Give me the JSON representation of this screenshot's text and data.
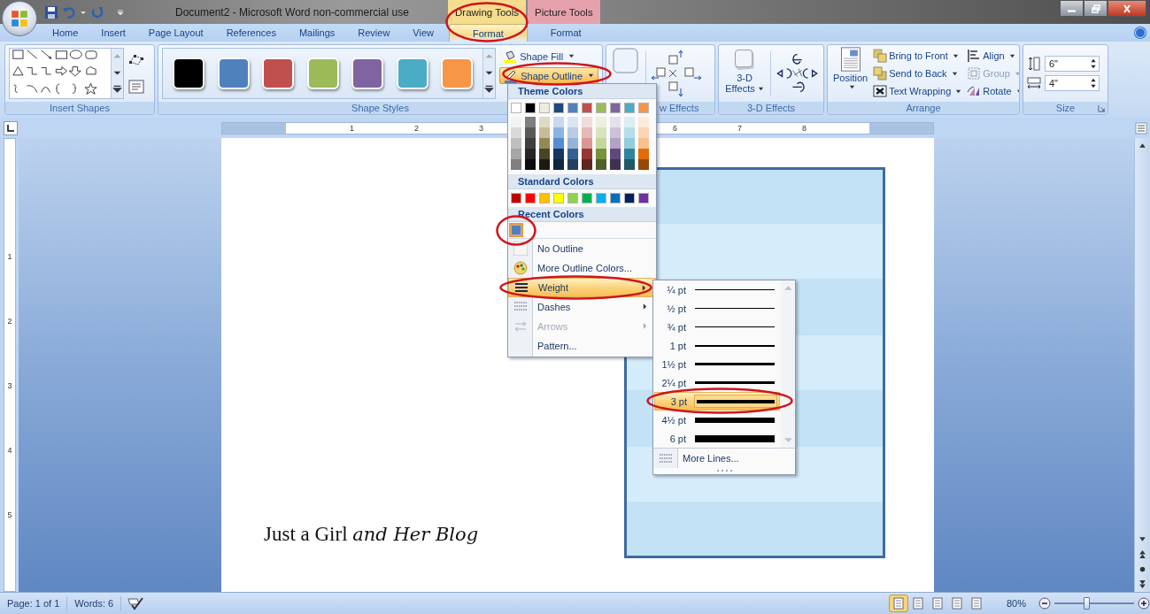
{
  "window": {
    "title": "Document2 - Microsoft Word non-commercial use",
    "contextual": [
      {
        "label": "Drawing Tools",
        "color": "#f6dc8e"
      },
      {
        "label": "Picture Tools",
        "color": "#e6a2ac"
      }
    ]
  },
  "tabs": [
    {
      "label": "Home",
      "selected": false,
      "kind": "standard"
    },
    {
      "label": "Insert",
      "selected": false,
      "kind": "standard"
    },
    {
      "label": "Page Layout",
      "selected": false,
      "kind": "standard"
    },
    {
      "label": "References",
      "selected": false,
      "kind": "standard"
    },
    {
      "label": "Mailings",
      "selected": false,
      "kind": "standard"
    },
    {
      "label": "Review",
      "selected": false,
      "kind": "standard"
    },
    {
      "label": "View",
      "selected": false,
      "kind": "standard"
    },
    {
      "label": "Format",
      "selected": true,
      "kind": "contextual"
    },
    {
      "label": "Format",
      "selected": false,
      "kind": "contextual"
    }
  ],
  "insert_shapes": {
    "label": "Insert Shapes"
  },
  "shape_styles": {
    "label": "Shape Styles",
    "swatches": [
      {
        "color": "#000000"
      },
      {
        "color": "#4f81bd"
      },
      {
        "color": "#c0504d"
      },
      {
        "color": "#9bbb59"
      },
      {
        "color": "#8064a2"
      },
      {
        "color": "#4bacc6"
      },
      {
        "color": "#f79646"
      }
    ],
    "fill": "Shape Fill",
    "outline": {
      "label": "Shape Outline",
      "open": true
    }
  },
  "shadow_effects": {
    "label": "w Effects"
  },
  "three_d_effects": {
    "button": "3-D Effects",
    "label": "3-D Effects"
  },
  "arrange": {
    "label": "Arrange",
    "position": "Position",
    "commands": [
      {
        "label": "Bring to Front",
        "disabled": false
      },
      {
        "label": "Send to Back",
        "disabled": false
      },
      {
        "label": "Text Wrapping",
        "disabled": false
      },
      {
        "label": "Align",
        "disabled": false
      },
      {
        "label": "Group",
        "disabled": true
      },
      {
        "label": "Rotate",
        "disabled": false
      }
    ]
  },
  "size": {
    "label": "Size",
    "height": "6\"",
    "width": "4\""
  },
  "ruler": {
    "numbers": [
      "1",
      "2",
      "3",
      "6",
      "7",
      "8"
    ]
  },
  "vertical_ruler": {
    "numbers": [
      "1",
      "2",
      "3",
      "4",
      "5"
    ]
  },
  "document": {
    "text": "Just a Girl *and Her Blog*"
  },
  "outline_menu": {
    "theme_heading": "Theme Colors",
    "theme_colors": [
      {
        "color": "#ffffff",
        "shades": [
          {
            "color": "#f2f2f2"
          },
          {
            "color": "#d9d9d9"
          },
          {
            "color": "#bfbfbf"
          },
          {
            "color": "#a6a6a6"
          },
          {
            "color": "#808080"
          }
        ]
      },
      {
        "color": "#000000",
        "shades": [
          {
            "color": "#7f7f7f"
          },
          {
            "color": "#595959"
          },
          {
            "color": "#3f3f3f"
          },
          {
            "color": "#262626"
          },
          {
            "color": "#0d0d0d"
          }
        ]
      },
      {
        "color": "#eeece1",
        "shades": [
          {
            "color": "#ddd9c3"
          },
          {
            "color": "#c4bd97"
          },
          {
            "color": "#938953"
          },
          {
            "color": "#494429"
          },
          {
            "color": "#1d1b10"
          }
        ]
      },
      {
        "color": "#1f497d",
        "shades": [
          {
            "color": "#c6d9f0"
          },
          {
            "color": "#8db3e2"
          },
          {
            "color": "#548dd4"
          },
          {
            "color": "#17365d"
          },
          {
            "color": "#0f243e"
          }
        ]
      },
      {
        "color": "#4f81bd",
        "shades": [
          {
            "color": "#dbe5f1"
          },
          {
            "color": "#b8cce4"
          },
          {
            "color": "#95b3d7"
          },
          {
            "color": "#366092"
          },
          {
            "color": "#244061"
          }
        ]
      },
      {
        "color": "#c0504d",
        "shades": [
          {
            "color": "#f2dcdb"
          },
          {
            "color": "#e5b9b7"
          },
          {
            "color": "#d99694"
          },
          {
            "color": "#953734"
          },
          {
            "color": "#632423"
          }
        ]
      },
      {
        "color": "#9bbb59",
        "shades": [
          {
            "color": "#ebf1dd"
          },
          {
            "color": "#d7e3bc"
          },
          {
            "color": "#c3d69b"
          },
          {
            "color": "#76923c"
          },
          {
            "color": "#4f6128"
          }
        ]
      },
      {
        "color": "#8064a2",
        "shades": [
          {
            "color": "#e5e0ec"
          },
          {
            "color": "#ccc1d9"
          },
          {
            "color": "#b2a2c7"
          },
          {
            "color": "#5f497a"
          },
          {
            "color": "#3f3151"
          }
        ]
      },
      {
        "color": "#4bacc6",
        "shades": [
          {
            "color": "#dbeef3"
          },
          {
            "color": "#b7dde8"
          },
          {
            "color": "#92cddc"
          },
          {
            "color": "#31859b"
          },
          {
            "color": "#205867"
          }
        ]
      },
      {
        "color": "#f79646",
        "shades": [
          {
            "color": "#fdeada"
          },
          {
            "color": "#fbd5b5"
          },
          {
            "color": "#fac08f"
          },
          {
            "color": "#e36c09"
          },
          {
            "color": "#974806"
          }
        ]
      }
    ],
    "standard_heading": "Standard Colors",
    "standard_colors": [
      {
        "color": "#c00000"
      },
      {
        "color": "#ff0000"
      },
      {
        "color": "#ffc000"
      },
      {
        "color": "#ffff00"
      },
      {
        "color": "#92d050"
      },
      {
        "color": "#00b050"
      },
      {
        "color": "#00b0f0"
      },
      {
        "color": "#0070c0"
      },
      {
        "color": "#002060"
      },
      {
        "color": "#7030a0"
      }
    ],
    "recent_heading": "Recent Colors",
    "recent_colors": [
      {
        "color": "#4f81bd",
        "selected": true
      }
    ],
    "items": [
      {
        "label": "No Outline",
        "highlighted": false,
        "disabled": false,
        "submenu": false
      },
      {
        "label": "More Outline Colors...",
        "highlighted": false,
        "disabled": false,
        "submenu": false
      },
      {
        "label": "Weight",
        "highlighted": true,
        "disabled": false,
        "submenu": true
      },
      {
        "label": "Dashes",
        "highlighted": false,
        "disabled": false,
        "submenu": true
      },
      {
        "label": "Arrows",
        "highlighted": false,
        "disabled": true,
        "submenu": true
      },
      {
        "label": "Pattern...",
        "highlighted": false,
        "disabled": false,
        "submenu": false
      }
    ]
  },
  "weight_menu": {
    "options": [
      {
        "label": "¼ pt",
        "selected": false
      },
      {
        "label": "½ pt",
        "selected": false
      },
      {
        "label": "¾ pt",
        "selected": false
      },
      {
        "label": "1 pt",
        "selected": false
      },
      {
        "label": "1½ pt",
        "selected": false
      },
      {
        "label": "2¼ pt",
        "selected": false
      },
      {
        "label": "3 pt",
        "selected": true
      },
      {
        "label": "4½ pt",
        "selected": false
      },
      {
        "label": "6 pt",
        "selected": false
      }
    ],
    "more": "More Lines..."
  },
  "status_bar": {
    "page": "Page: 1 of 1",
    "words": "Words: 6",
    "views": [
      {
        "selected": true
      },
      {
        "selected": false
      },
      {
        "selected": false
      },
      {
        "selected": false
      },
      {
        "selected": false
      }
    ],
    "zoom": "80%",
    "zoom_slider": {
      "level": 0.4
    }
  }
}
